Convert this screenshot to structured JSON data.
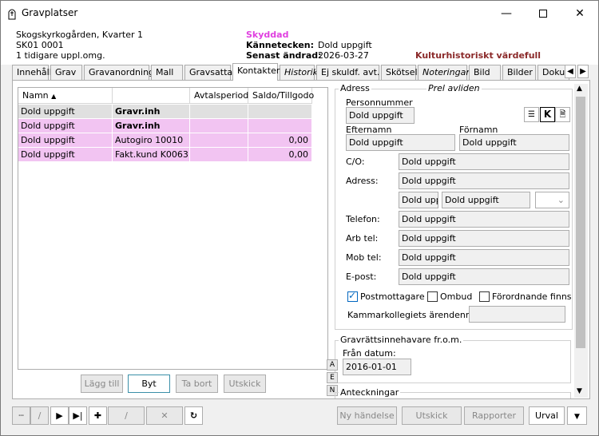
{
  "window": {
    "title": "Gravplatser",
    "min_icon": "minimize-icon",
    "max_icon": "maximize-icon",
    "close_icon": "close-icon"
  },
  "header": {
    "cemetery": "Skogskyrkogården, Kvarter 1",
    "plot_id": "SK01 0001",
    "previous": "1 tidigare uppl.omg.",
    "protected": "Skyddad",
    "mark_label": "Kännetecken:",
    "mark_value": "Dold uppgift",
    "changed_label": "Senast ändrad:",
    "changed_value": "2026-03-27",
    "heritage": "Kulturhistoriskt värdefull"
  },
  "tabs": [
    "Innehåll",
    "Grav",
    "Gravanordning",
    "Mall",
    "Gravsatta",
    "Kontakter",
    "Historik",
    "Ej skuldf. avt.",
    "Skötsel",
    "Noteringar",
    "Bild",
    "Bilder",
    "Dokum"
  ],
  "active_tab": "Kontakter",
  "grid": {
    "headers": [
      "Namn",
      "",
      "Avtalsperiod",
      "Saldo/Tillgodo"
    ],
    "rows": [
      {
        "name": "Dold uppgift",
        "role": "Gravr.inh",
        "period": "",
        "saldo": ""
      },
      {
        "name": "Dold uppgift",
        "role": "Gravr.inh",
        "period": "",
        "saldo": ""
      },
      {
        "name": "Dold uppgift",
        "role": "Autogiro 10010",
        "period": "",
        "saldo": "0,00"
      },
      {
        "name": "Dold uppgift",
        "role": "Fakt.kund K0063",
        "period": "",
        "saldo": "0,00"
      }
    ]
  },
  "grid_buttons": {
    "add": "Lägg till",
    "swap": "Byt",
    "remove": "Ta bort",
    "dispatch": "Utskick"
  },
  "address": {
    "group_title": "Adress",
    "deceased": "Prel avliden",
    "pnr_label": "Personnummer",
    "pnr": "Dold uppgift",
    "k_button": "K",
    "last_label": "Efternamn",
    "last": "Dold uppgift",
    "first_label": "Förnamn",
    "first": "Dold uppgift",
    "co_label": "C/O:",
    "co": "Dold uppgift",
    "addr_label": "Adress:",
    "addr": "Dold uppgift",
    "zip": "Dold uppgift",
    "city": "Dold uppgift",
    "phone_label": "Telefon:",
    "phone": "Dold uppgift",
    "work_label": "Arb tel:",
    "work": "Dold uppgift",
    "mob_label": "Mob tel:",
    "mob": "Dold uppgift",
    "email_label": "E-post:",
    "email": "Dold uppgift",
    "post_recv": "Postmottagare",
    "ombud": "Ombud",
    "forord": "Förordnande finns",
    "kammar_label": "Kammarkollegiets ärendenr:",
    "kammar": ""
  },
  "holder": {
    "group_title": "Gravrättsinnehavare fr.o.m.",
    "from_label": "Från datum:",
    "from": "2016-01-01"
  },
  "aen": [
    "A",
    "E",
    "N"
  ],
  "notes_title": "Anteckningar",
  "bottom": {
    "new_event": "Ny händelse",
    "dispatch": "Utskick",
    "reports": "Rapporter",
    "select": "Urval"
  }
}
